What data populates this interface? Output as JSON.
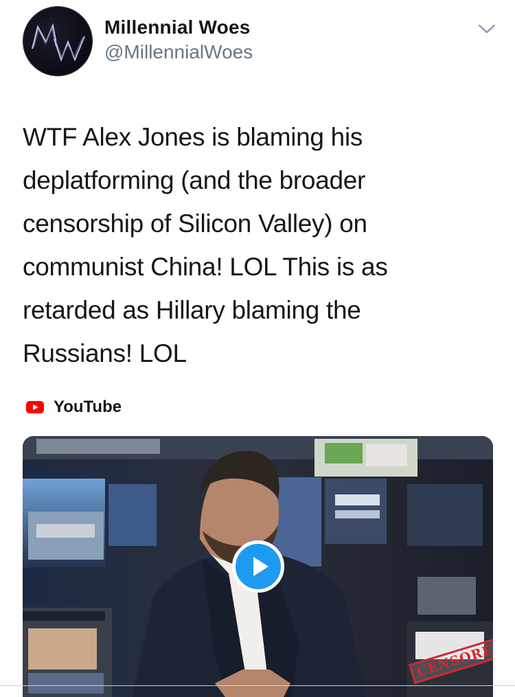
{
  "author": {
    "avatar_label": "MW",
    "display_name": "Millennial Woes",
    "handle": "@MillennialWoes"
  },
  "menu_icon": "chevron-down-icon",
  "tweet": {
    "text": "WTF Alex Jones is blaming his\ndeplatforming (and the broader\ncensorship of Silicon Valley) on\ncommunist China! LOL This is as\nretarded as Hillary blaming the\nRussians! LOL"
  },
  "card": {
    "source_icon": "youtube-icon",
    "source_name": "YouTube",
    "play_icon": "play-icon",
    "stamp_text": "CENSORED",
    "colors": {
      "play_button": "#1d9bf0",
      "youtube_red": "#ff0000",
      "stamp_red": "#d22630"
    }
  }
}
